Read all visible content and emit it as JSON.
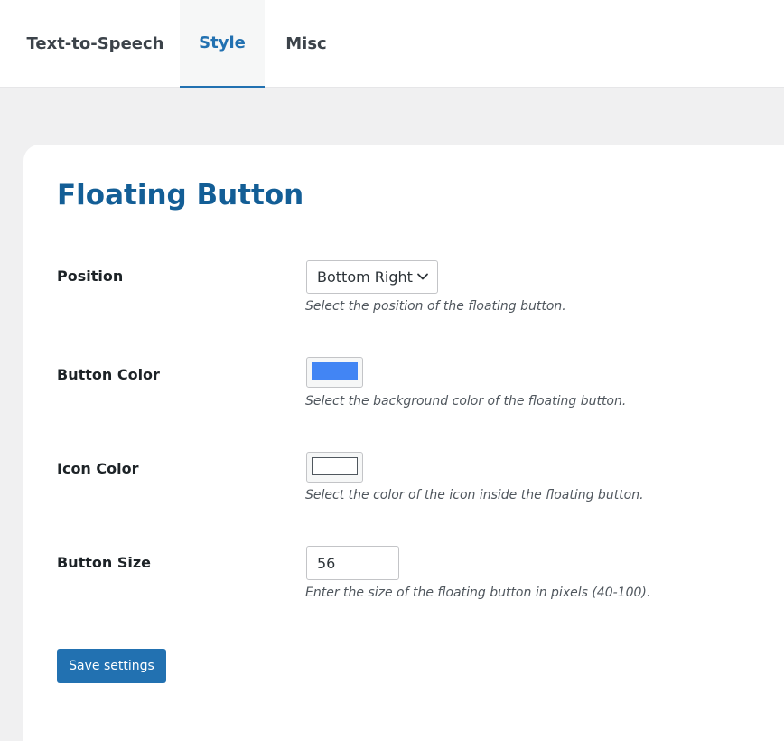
{
  "tabs": [
    {
      "label": "Text-to-Speech",
      "active": false
    },
    {
      "label": "Style",
      "active": true
    },
    {
      "label": "Misc",
      "active": false
    }
  ],
  "section": {
    "title": "Floating Button"
  },
  "fields": {
    "position": {
      "label": "Position",
      "value": "Bottom Right",
      "description": "Select the position of the floating button."
    },
    "button_color": {
      "label": "Button Color",
      "value": "#4285f4",
      "description": "Select the background color of the floating button."
    },
    "icon_color": {
      "label": "Icon Color",
      "value": "#ffffff",
      "description": "Select the color of the icon inside the floating button."
    },
    "button_size": {
      "label": "Button Size",
      "value": "56",
      "description": "Enter the size of the floating button in pixels (40-100)."
    }
  },
  "save_label": "Save settings",
  "colors": {
    "accent": "#2271b1",
    "title": "#135e96",
    "background": "#f0f0f1"
  }
}
